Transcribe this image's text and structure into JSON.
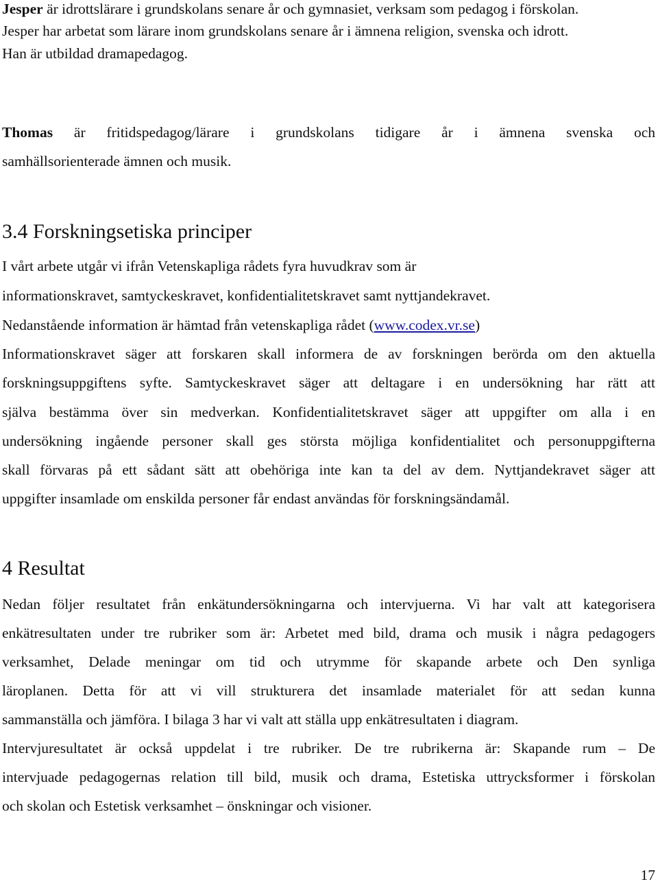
{
  "page_number": "17",
  "link_color": "#1a1a9e",
  "persons": {
    "jesper": {
      "name": "Jesper",
      "line1_rest": " är idrottslärare i grundskolans senare år och gymnasiet, verksam som pedagog i förskolan.",
      "line2": "Jesper har arbetat som lärare inom grundskolans senare år i ämnena religion, svenska och idrott.",
      "line3": "Han är utbildad dramapedagog."
    },
    "thomas": {
      "name": "Thomas",
      "line1_rest": " är fritidspedagog/lärare i grundskolans tidigare år i ämnena svenska och",
      "line2": "samhällsorienterade ämnen och musik."
    }
  },
  "section_3_4": {
    "heading": "3.4 Forskningsetiska principer",
    "lines": [
      "I vårt arbete utgår vi ifrån Vetenskapliga rådets fyra huvudkrav som är",
      "informationskravet, samtyckeskravet, konfidentialitetskravet samt nyttjandekravet."
    ],
    "source_prefix": "Nedanstående information är hämtad från vetenskapliga rådet (",
    "source_link": "www.codex.vr.se",
    "source_suffix": ")",
    "paragraph_lines": [
      "Informationskravet säger att forskaren skall informera de av forskningen berörda om den aktuella",
      "forskningsuppgiftens syfte. Samtyckeskravet säger att deltagare i en undersökning har rätt att",
      "själva bestämma över sin medverkan. Konfidentialitetskravet säger att uppgifter om alla i en",
      "undersökning ingående personer skall ges största möjliga konfidentialitet och personuppgifterna",
      "skall förvaras på ett sådant sätt att obehöriga inte kan ta del av dem. Nyttjandekravet säger att",
      "uppgifter insamlade om enskilda personer får endast användas för forskningsändamål."
    ]
  },
  "section_4": {
    "heading": "4 Resultat",
    "paragraph1_lines": [
      "Nedan följer resultatet från enkätundersökningarna och intervjuerna. Vi har valt att kategorisera",
      "enkätresultaten under tre rubriker som är: Arbetet med bild, drama och musik i några pedagogers",
      "verksamhet, Delade meningar om tid och utrymme för skapande arbete och Den synliga",
      "läroplanen. Detta för att vi vill strukturera det insamlade materialet för att sedan kunna",
      "sammanställa och jämföra. I bilaga 3 har vi valt att ställa upp enkätresultaten i diagram."
    ],
    "paragraph2_lines": [
      "Intervjuresultatet är också uppdelat i tre rubriker. De tre rubrikerna är: Skapande rum – De",
      "intervjuade pedagogernas relation till bild, musik och drama, Estetiska uttrycksformer i förskolan",
      "och skolan och Estetisk verksamhet – önskningar och visioner."
    ]
  }
}
